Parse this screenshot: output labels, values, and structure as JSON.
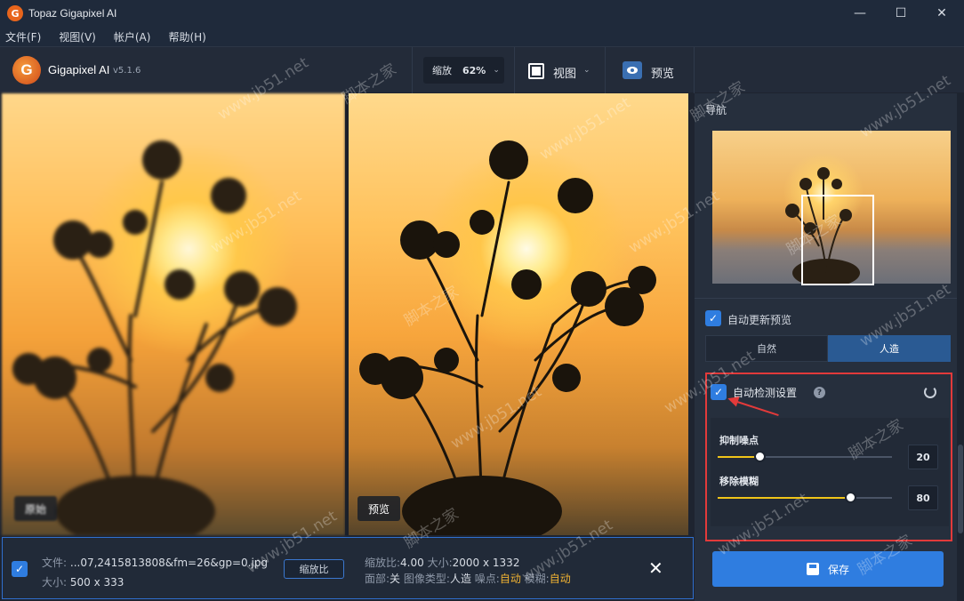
{
  "window": {
    "title": "Topaz Gigapixel AI",
    "controls": {
      "minimize": "—",
      "maximize": "☐",
      "close": "✕"
    }
  },
  "menubar": {
    "items": [
      {
        "label": "文件(F)"
      },
      {
        "label": "视图(V)"
      },
      {
        "label": "帐户(A)"
      },
      {
        "label": "帮助(H)"
      }
    ]
  },
  "toolbar": {
    "logo_letter": "G",
    "app_name": "Gigapixel AI",
    "version": "v5.1.6",
    "zoom_label": "缩放",
    "zoom_value": "62%",
    "view_label": "视图",
    "preview_label": "预览"
  },
  "images": {
    "left_tag": "原始",
    "right_tag": "预览"
  },
  "infobar": {
    "file_label": "文件:",
    "file_name": "...07,2415813808&fm=26&gp=0.jpg",
    "size_label": "大小:",
    "size_value": "500 x 333",
    "scale_button": "缩放比",
    "scale_label": "缩放比:",
    "scale_value": "4.00",
    "out_size_label": "大小:",
    "out_size_value": "2000 x 1332",
    "face_label": "面部:",
    "face_value": "关",
    "image_type_label": "图像类型:",
    "image_type_value": "人造",
    "noise_label": "噪点:",
    "noise_value": "自动",
    "blur_label": "模糊:",
    "blur_value": "自动",
    "close_symbol": "✕"
  },
  "panel": {
    "nav_title": "导航",
    "auto_update_label": "自动更新预览",
    "model_options": [
      "自然",
      "人造"
    ],
    "selected_model": "人造",
    "auto_detect_label": "自动检测设置",
    "help_symbol": "?",
    "sliders": [
      {
        "label": "抑制噪点",
        "value": "20",
        "level": 0.24
      },
      {
        "label": "移除模糊",
        "value": "80",
        "level": 0.76
      }
    ],
    "save_label": "保存"
  },
  "watermarks": [
    "www.jb51.net",
    "脚本之家"
  ],
  "colors": {
    "accent": "#2f7de0",
    "highlight_box": "#e23a3a",
    "auto_text": "#f0b232",
    "slider_fill": "#f0c419"
  }
}
